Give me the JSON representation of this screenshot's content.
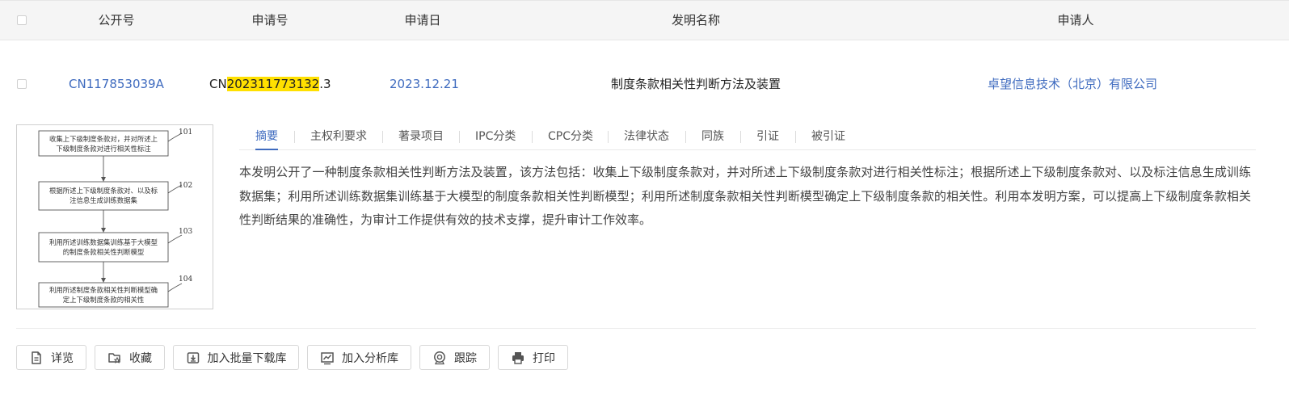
{
  "columns": [
    "公开号",
    "申请号",
    "申请日",
    "发明名称",
    "申请人"
  ],
  "record": {
    "pub_no": "CN117853039A",
    "app_no_prefix": "CN",
    "app_no_highlight": "202311773132",
    "app_no_suffix": ".3",
    "app_date": "2023.12.21",
    "title": "制度条款相关性判断方法及装置",
    "applicant": "卓望信息技术（北京）有限公司"
  },
  "figure": {
    "steps": [
      {
        "num": "101",
        "lines": [
          "收集上下级制度条款对，并对所述上",
          "下级制度条款对进行相关性标注"
        ]
      },
      {
        "num": "102",
        "lines": [
          "根据所述上下级制度条款对、以及标",
          "注信息生成训练数据集"
        ]
      },
      {
        "num": "103",
        "lines": [
          "利用所述训练数据集训练基于大模型",
          "的制度条款相关性判断模型"
        ]
      },
      {
        "num": "104",
        "lines": [
          "利用所述制度条款相关性判断模型确",
          "定上下级制度条款的相关性"
        ]
      }
    ]
  },
  "tabs": [
    "摘要",
    "主权利要求",
    "著录项目",
    "IPC分类",
    "CPC分类",
    "法律状态",
    "同族",
    "引证",
    "被引证"
  ],
  "active_tab": "摘要",
  "abstract": "本发明公开了一种制度条款相关性判断方法及装置，该方法包括：收集上下级制度条款对，并对所述上下级制度条款对进行相关性标注；根据所述上下级制度条款对、以及标注信息生成训练数据集；利用所述训练数据集训练基于大模型的制度条款相关性判断模型；利用所述制度条款相关性判断模型确定上下级制度条款的相关性。利用本发明方案，可以提高上下级制度条款相关性判断结果的准确性，为审计工作提供有效的技术支撑，提升审计工作效率。",
  "actions": [
    {
      "label": "详览",
      "icon": "document-icon"
    },
    {
      "label": "收藏",
      "icon": "folder-star-icon"
    },
    {
      "label": "加入批量下载库",
      "icon": "download-icon"
    },
    {
      "label": "加入分析库",
      "icon": "analysis-chart-icon"
    },
    {
      "label": "跟踪",
      "icon": "tracking-icon"
    },
    {
      "label": "打印",
      "icon": "printer-icon"
    }
  ],
  "colors": {
    "link": "#3f6bbf",
    "highlight": "#ffe000",
    "header_bg": "#f5f5f5"
  }
}
